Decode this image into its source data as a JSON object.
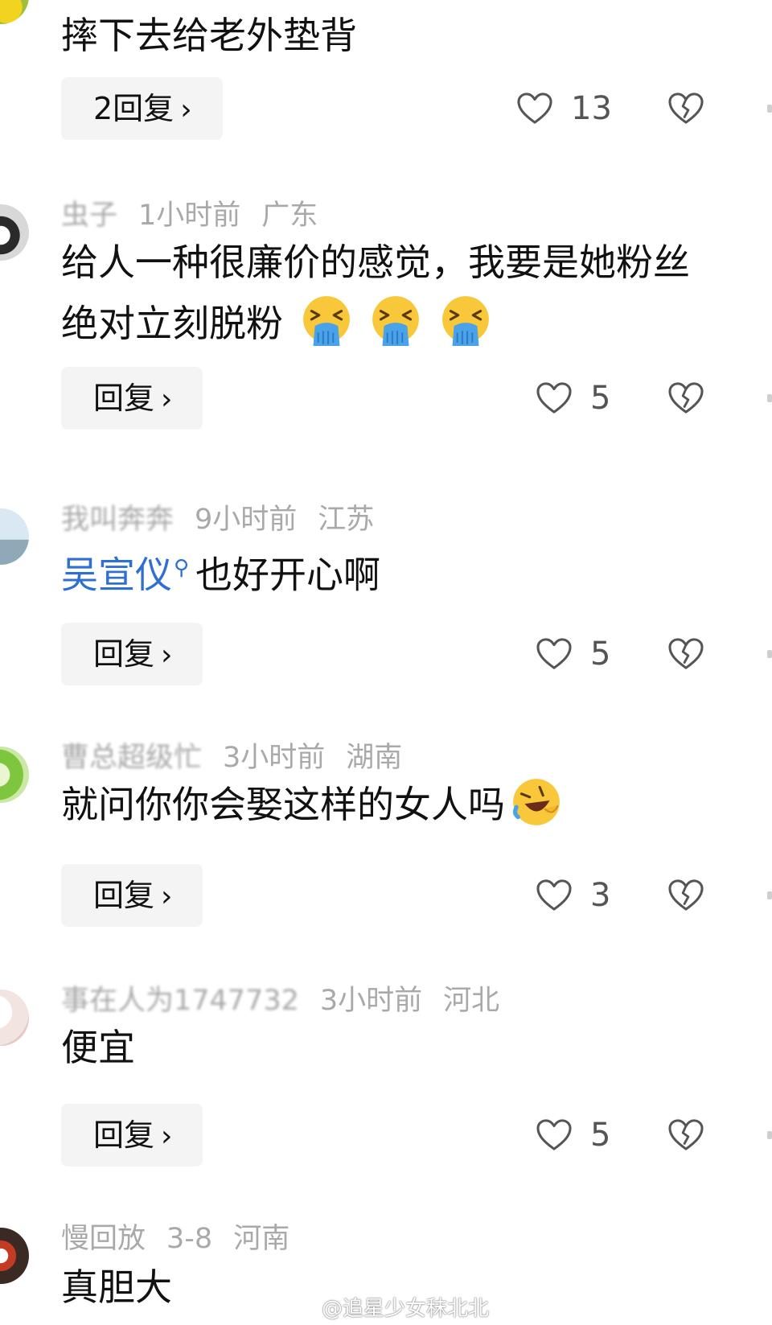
{
  "comments": [
    {
      "text": "摔下去给老外垫背",
      "reply_label": "2回复",
      "likes": "13"
    },
    {
      "username": "虫子",
      "time": "1小时前",
      "location": "广东",
      "text_line1": "给人一种很廉价的感觉，我要是她粉丝",
      "text_line2": "绝对立刻脱粉",
      "reply_label": "回复",
      "likes": "5"
    },
    {
      "username": "我叫奔奔",
      "time": "9小时前",
      "location": "江苏",
      "mention": "吴宣仪",
      "text": "也好开心啊",
      "reply_label": "回复",
      "likes": "5"
    },
    {
      "username": "曹总超级忙",
      "time": "3小时前",
      "location": "湖南",
      "text": "就问你你会娶这样的女人吗",
      "reply_label": "回复",
      "likes": "3"
    },
    {
      "username": "事在人为1747732",
      "time": "3小时前",
      "location": "河北",
      "text": "便宜",
      "reply_label": "回复",
      "likes": "5"
    },
    {
      "username": "慢回放",
      "time": "3-8",
      "location": "河南",
      "text": "真胆大"
    }
  ],
  "icons": {
    "like": "heart-outline-icon",
    "dislike": "broken-heart-icon",
    "chevron": "chevron-right-icon",
    "mention": "search-icon",
    "emoji_vomit": "face-vomiting-emoji",
    "emoji_laugh": "rolling-laughing-emoji"
  },
  "watermark": "@追星少女秣北北",
  "colors": {
    "meta_gray": "#a9a9a9",
    "mention_blue": "#2f6fd1",
    "reply_bg": "#f4f4f4",
    "icon_gray": "#555555"
  }
}
